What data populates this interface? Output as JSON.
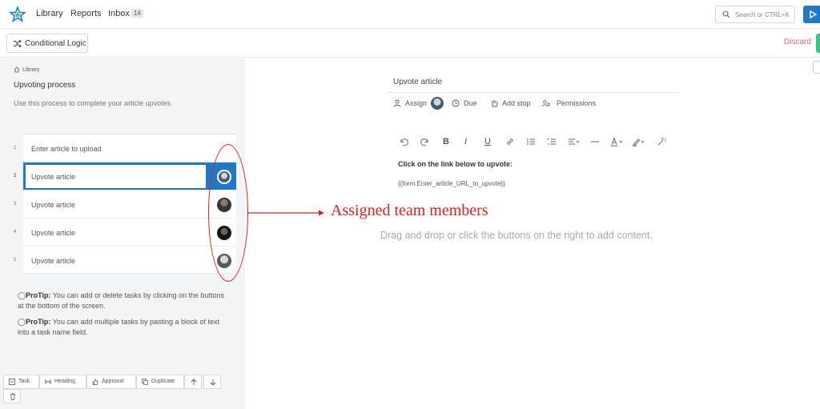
{
  "nav": {
    "links": [
      "Library",
      "Reports",
      "Inbox"
    ],
    "inbox_count": "14",
    "search_placeholder": "Search or CTRL+K",
    "accent": "#1f78c8"
  },
  "toolbar": {
    "conditional_logic_label": "Conditional Logic",
    "discard_label": "Discard"
  },
  "panel": {
    "breadcrumb": "Library",
    "title": "Upvoting process",
    "description": "Use this process to complete your article upvotes",
    "tasks": [
      {
        "num": "1",
        "name": "Enter article to upload"
      },
      {
        "num": "2",
        "name": "Upvote article"
      },
      {
        "num": "3",
        "name": "Upvote article"
      },
      {
        "num": "4",
        "name": "Upvote article"
      },
      {
        "num": "5",
        "name": "Upvote article"
      }
    ],
    "tips": [
      {
        "label": "ProTip:",
        "text": " You can add or delete tasks by clicking on the buttons at the bottom of the screen."
      },
      {
        "label": "ProTip:",
        "text": " You can add multiple tasks by pasting a block of text into a task name field."
      }
    ],
    "bottom_buttons": [
      "Task",
      "Heading",
      "Approval",
      "Duplicate"
    ]
  },
  "editor": {
    "task_title": "Upvote article",
    "meta": [
      "Assign",
      "Due",
      "Add stop",
      "Permissions"
    ],
    "content_bold": "Click on the link below to upvote:",
    "content_var": "{{form.Enter_article_URL_to_upvote}}",
    "empty_hint": "Drag and drop or click the buttons on the right to add content."
  },
  "annotation": {
    "text": "Assigned team members",
    "color": "#e02020"
  }
}
